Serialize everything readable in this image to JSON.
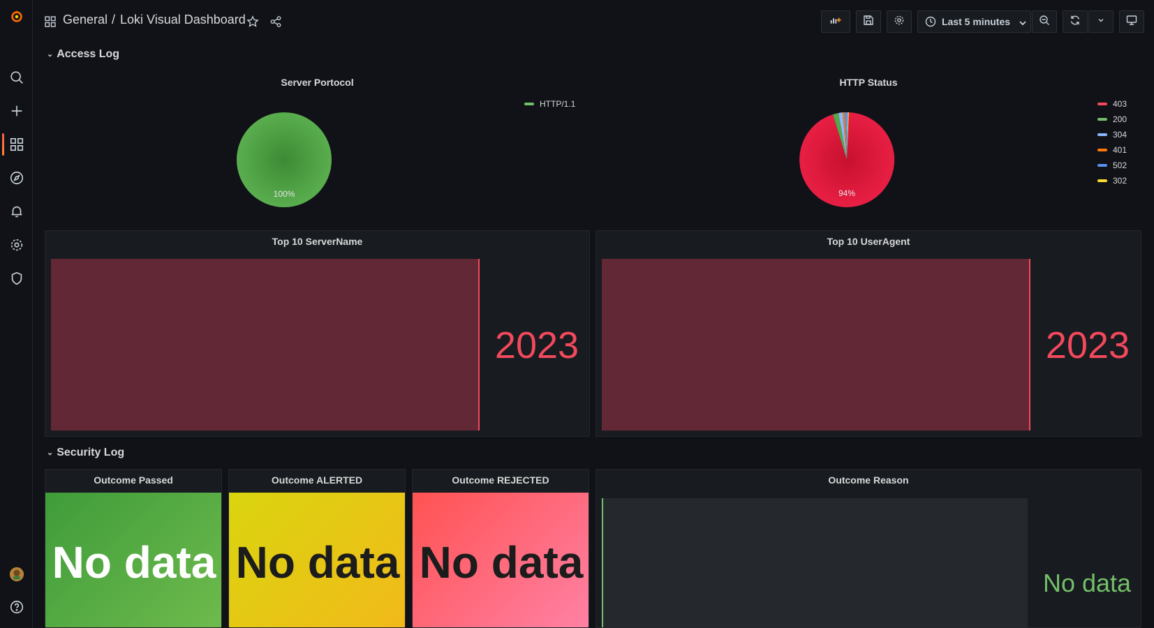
{
  "nav": {
    "icons": [
      "grafana-logo-icon",
      "search-icon",
      "plus-icon",
      "dashboards-icon",
      "explore-icon",
      "alerting-icon",
      "configuration-icon",
      "shield-icon",
      "avatar",
      "help-icon"
    ]
  },
  "header": {
    "folder": "General",
    "separator": "/",
    "title": "Loki Visual Dashboard",
    "time_range": "Last 5 minutes"
  },
  "rows": {
    "access": {
      "title": "Access Log"
    },
    "security": {
      "title": "Security Log"
    }
  },
  "panels": {
    "server_protocol": {
      "title": "Server Portocol",
      "slice_label": "100%",
      "legend": [
        {
          "label": "HTTP/1.1",
          "color": "#73bf69"
        }
      ]
    },
    "http_status": {
      "title": "HTTP Status",
      "slice_label": "94%",
      "legend": [
        {
          "label": "403",
          "color": "#f2495c"
        },
        {
          "label": "200",
          "color": "#73bf69"
        },
        {
          "label": "304",
          "color": "#8ab8ff"
        },
        {
          "label": "401",
          "color": "#ff780a"
        },
        {
          "label": "502",
          "color": "#5794f2"
        },
        {
          "label": "302",
          "color": "#fade2a"
        }
      ]
    },
    "top_servername": {
      "title": "Top 10 ServerName",
      "value": "2023"
    },
    "top_useragent": {
      "title": "Top 10 UserAgent",
      "value": "2023"
    },
    "outcome_passed": {
      "title": "Outcome Passed",
      "value": "No data"
    },
    "outcome_alerted": {
      "title": "Outcome ALERTED",
      "value": "No data"
    },
    "outcome_rejected": {
      "title": "Outcome REJECTED",
      "value": "No data"
    },
    "outcome_reason": {
      "title": "Outcome Reason",
      "value": "No data"
    }
  },
  "colors": {
    "red": "#f2495c",
    "green": "#73bf69",
    "pie_red": "#e0163c",
    "pie_green": "#56a64b"
  }
}
